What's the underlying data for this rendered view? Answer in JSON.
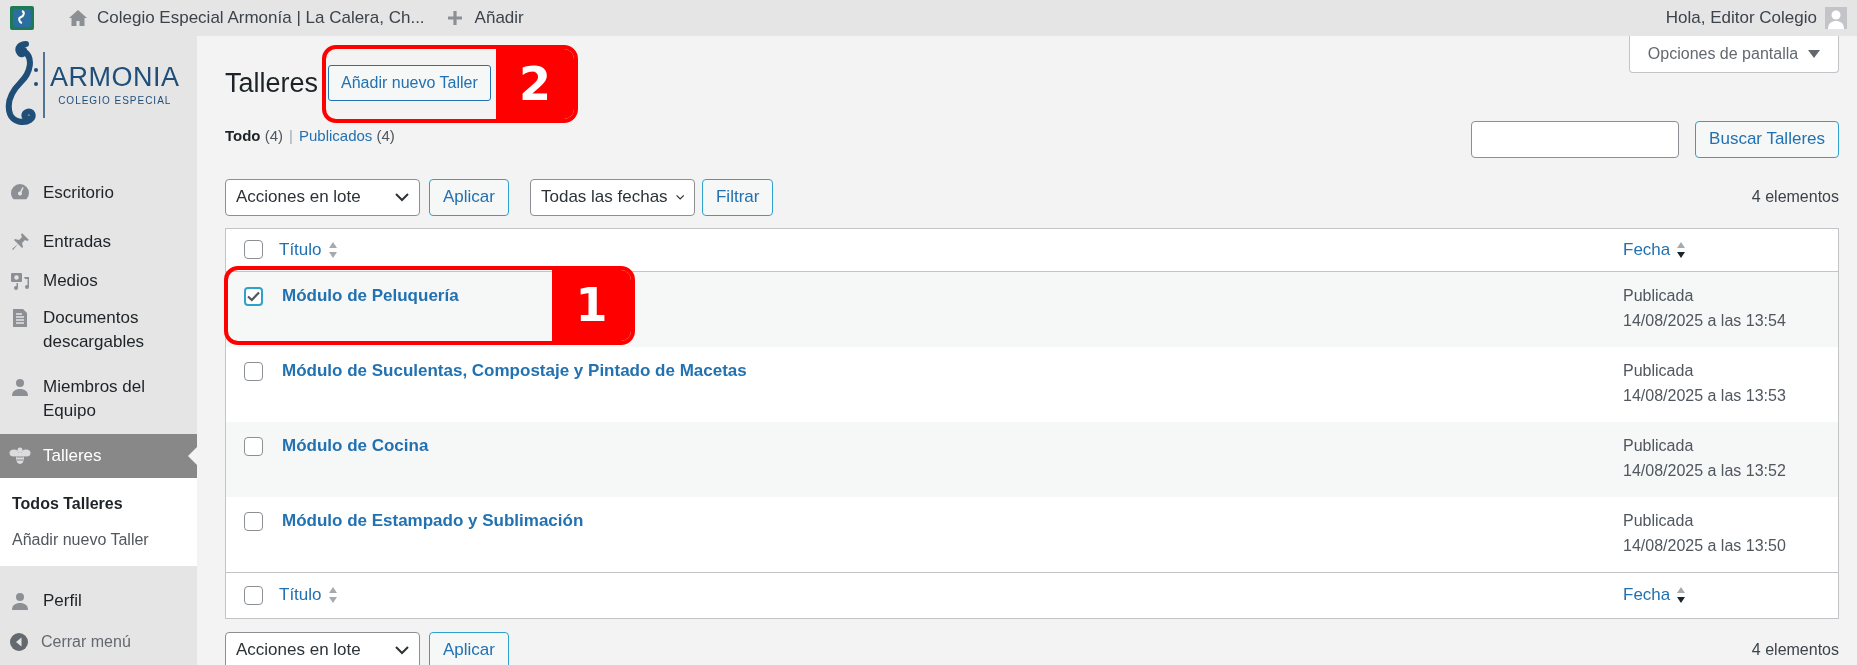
{
  "admin_bar": {
    "site_title": "Colegio Especial Armonía | La Calera, Ch...",
    "new_label": "Añadir",
    "greeting": "Hola, Editor Colegio"
  },
  "logo": {
    "name": "ARMONIA",
    "tagline": "COLEGIO ESPECIAL"
  },
  "sidebar": {
    "items": [
      {
        "label": "Escritorio",
        "kind": "dashboard",
        "selected": false
      },
      {
        "label": "Entradas",
        "kind": "pin",
        "selected": false
      },
      {
        "label": "Medios",
        "kind": "media",
        "selected": false
      },
      {
        "label": "Documentos descargables",
        "kind": "document",
        "selected": false
      },
      {
        "label": "Miembros del Equipo",
        "kind": "person",
        "selected": false
      },
      {
        "label": "Talleres",
        "kind": "bee",
        "selected": true,
        "children": [
          {
            "label": "Todos Talleres",
            "selected": true
          },
          {
            "label": "Añadir nuevo Taller",
            "selected": false
          }
        ]
      },
      {
        "label": "Perfil",
        "kind": "person",
        "selected": false
      }
    ],
    "collapse_label": "Cerrar menú"
  },
  "page": {
    "title": "Talleres",
    "add_button": "Añadir nuevo Taller",
    "screen_options": "Opciones de pantalla",
    "views": [
      {
        "label": "Todo",
        "count": "(4)",
        "selected": true
      },
      {
        "label": "Publicados",
        "count": "(4)",
        "selected": false
      }
    ],
    "views_separator": "|",
    "search_button": "Buscar Talleres",
    "bulk_select": "Acciones en lote",
    "apply_button": "Aplicar",
    "date_select": "Todas las fechas",
    "filter_button": "Filtrar",
    "item_count": "4 elementos",
    "table": {
      "select_all_checked": false,
      "columns": [
        {
          "label": "Título",
          "sorted": false
        },
        {
          "label": "Fecha",
          "sorted": true
        }
      ],
      "footer_select_all_checked": false,
      "footer_columns": [
        {
          "label": "Título",
          "sorted": false
        },
        {
          "label": "Fecha",
          "sorted": true
        }
      ],
      "rows": [
        {
          "title": "Módulo de Peluquería",
          "status": "Publicada",
          "date": "14/08/2025 a las 13:54",
          "checked": true
        },
        {
          "title": "Módulo de Suculentas, Compostaje y Pintado de Macetas",
          "status": "Publicada",
          "date": "14/08/2025 a las 13:53",
          "checked": false
        },
        {
          "title": "Módulo de Cocina",
          "status": "Publicada",
          "date": "14/08/2025 a las 13:52",
          "checked": false
        },
        {
          "title": "Módulo de Estampado y Sublimación",
          "status": "Publicada",
          "date": "14/08/2025 a las 13:50",
          "checked": false
        }
      ]
    },
    "bottom_bulk_select": "Acciones en lote",
    "bottom_apply_button": "Aplicar",
    "bottom_item_count": "4 elementos",
    "annotations": [
      {
        "number": "2"
      },
      {
        "number": "1"
      }
    ]
  }
}
